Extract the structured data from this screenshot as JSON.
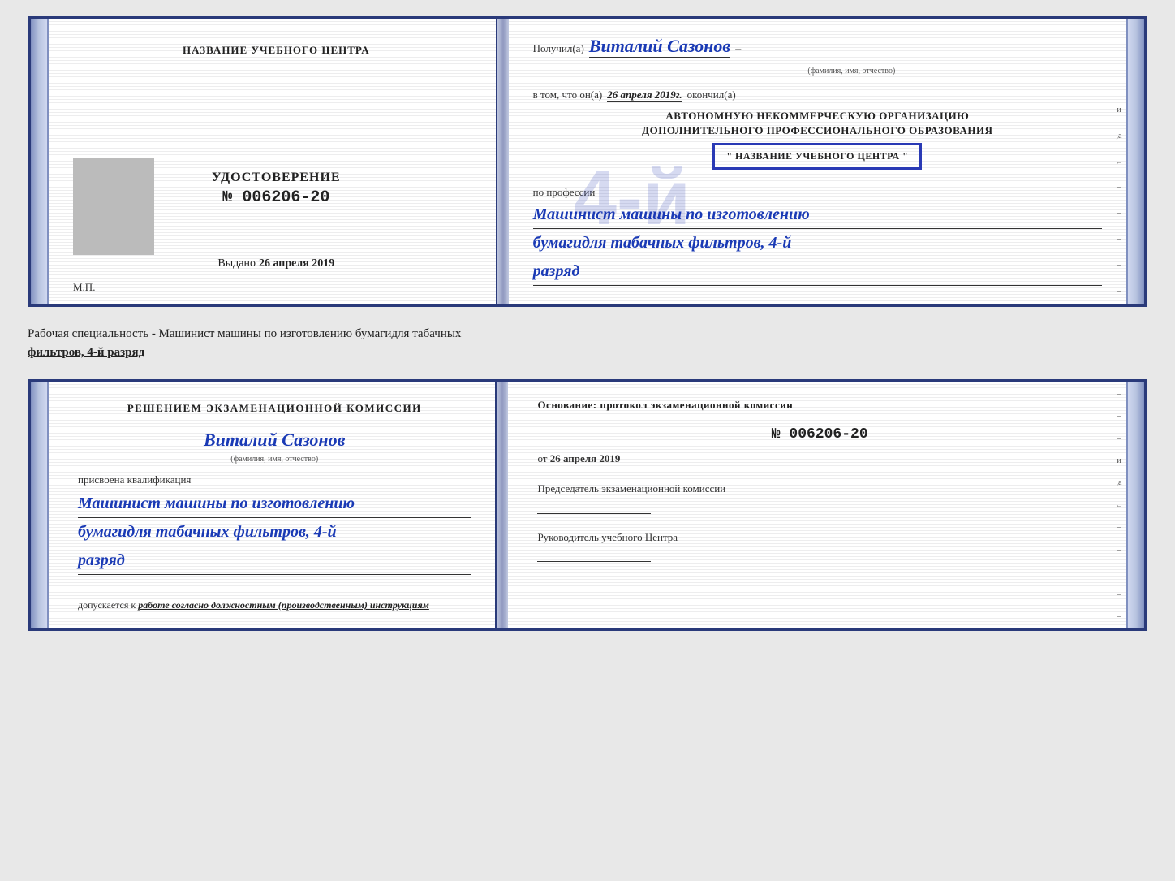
{
  "topCert": {
    "leftPage": {
      "schoolNameLabel": "НАЗВАНИЕ УЧЕБНОГО ЦЕНТРА",
      "udostoverenie": "УДОСТОВЕРЕНИЕ",
      "number": "№ 006206-20",
      "vydanoLabel": "Выдано",
      "vydanoDate": "26 апреля 2019",
      "mpLabel": "М.П."
    },
    "rightPage": {
      "poluchilLabel": "Получил(а)",
      "handwrittenName": "Виталий Сазонов",
      "nameCaption": "(фамилия, имя, отчество)",
      "dashAfterName": "–",
      "vtomLabel": "в том, что он(а)",
      "vtomDate": "26 апреля 2019г.",
      "okochilLabel": "окончил(а)",
      "bigNumber": "4-й",
      "orgLine1": "АВТОНОМНУЮ НЕКОММЕРЧЕСКУЮ ОРГАНИЗАЦИЮ",
      "orgLine2": "ДОПОЛНИТЕЛЬНОГО ПРОФЕССИОНАЛЬНОГО ОБРАЗОВАНИЯ",
      "orgLine3": "\" НАЗВАНИЕ УЧЕБНОГО ЦЕНТРА \"",
      "poProf": "по профессии",
      "profLine1": "Машинист машины по изготовлению",
      "profLine2": "бумагидля табачных фильтров, 4-й",
      "profLine3": "разряд",
      "sideDeco": [
        "–",
        "–",
        "–",
        "и",
        ",а",
        "←",
        "–",
        "–",
        "–",
        "–",
        "–"
      ]
    }
  },
  "infoText": {
    "main": "Рабочая специальность - Машинист машины по изготовлению бумагидля табачных",
    "underline": "фильтров, 4-й разряд"
  },
  "bottomCert": {
    "leftPage": {
      "resheniyemLabel": "Решением экзаменационной комиссии",
      "handwrittenName": "Виталий Сазонов",
      "nameCaption": "(фамилия, имя, отчество)",
      "prisvoyenaLabel": "присвоена квалификация",
      "qualLine1": "Машинист машины по изготовлению",
      "qualLine2": "бумагидля табачных фильтров, 4-й",
      "qualLine3": "разряд",
      "dopuskaetsyaLabel": "допускается к",
      "dopuskaetsyaText": "работе согласно должностным (производственным) инструкциям"
    },
    "rightPage": {
      "osnovLabel": "Основание: протокол экзаменационной комиссии",
      "osnovNumber": "№ 006206-20",
      "otLabel": "от",
      "otDate": "26 апреля 2019",
      "chairmanLabel": "Председатель экзаменационной комиссии",
      "rukovLabel": "Руководитель учебного Центра",
      "sideDeco": [
        "–",
        "–",
        "–",
        "и",
        ",а",
        "←",
        "–",
        "–",
        "–",
        "–",
        "–"
      ]
    }
  }
}
